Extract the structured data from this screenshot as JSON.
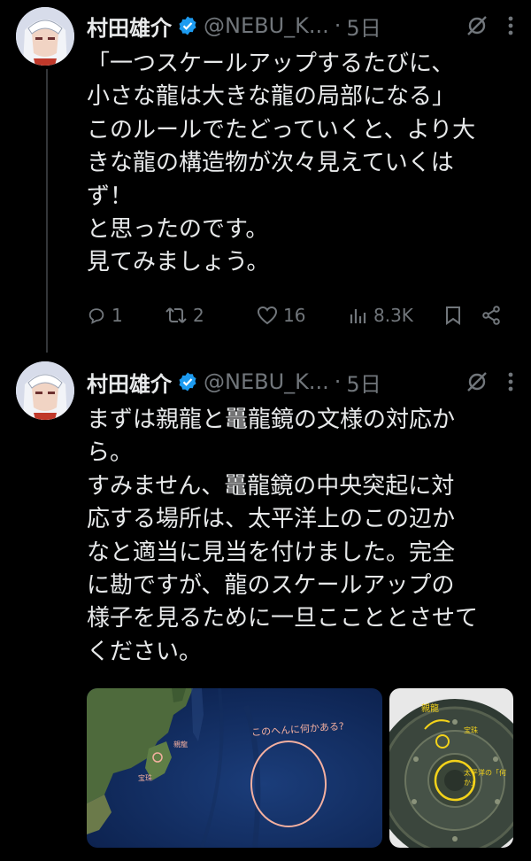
{
  "tweets": [
    {
      "display_name": "村田雄介",
      "handle": "@NEBU_K...",
      "separator": "·",
      "time": "5日",
      "text": "「一つスケールアップするたびに、\n小さな龍は大きな龍の局部になる」\nこのルールでたどっていくと、より大\nきな龍の構造物が次々見えていくは\nず！\nと思ったのです。\n見てみましょう。",
      "replies": "1",
      "retweets": "2",
      "likes": "16",
      "views": "8.3K"
    },
    {
      "display_name": "村田雄介",
      "handle": "@NEBU_K...",
      "separator": "·",
      "time": "5日",
      "text": "まずは親龍と鼉龍鏡の文様の対応か\nら。\nすみません、鼉龍鏡の中央突起に対\n応する場所は、太平洋上のこの辺か\nなと適当に見当を付けました。完全\nに勘ですが、龍のスケールアップの\n様子を見るために一旦ここととさせて\nください。",
      "media": {
        "map_annotation": "このへんに何かある?",
        "map_label_1": "親龍",
        "map_label_2": "宝珠",
        "mirror_label_top": "親龍",
        "mirror_label_right_1": "宝珠",
        "mirror_label_right_2": "太平洋の「何か」"
      }
    }
  ],
  "colors": {
    "accent": "#1d9bf0",
    "muted": "#71767b",
    "annotation": "#f4b0a0",
    "highlight": "#f3d21a"
  }
}
